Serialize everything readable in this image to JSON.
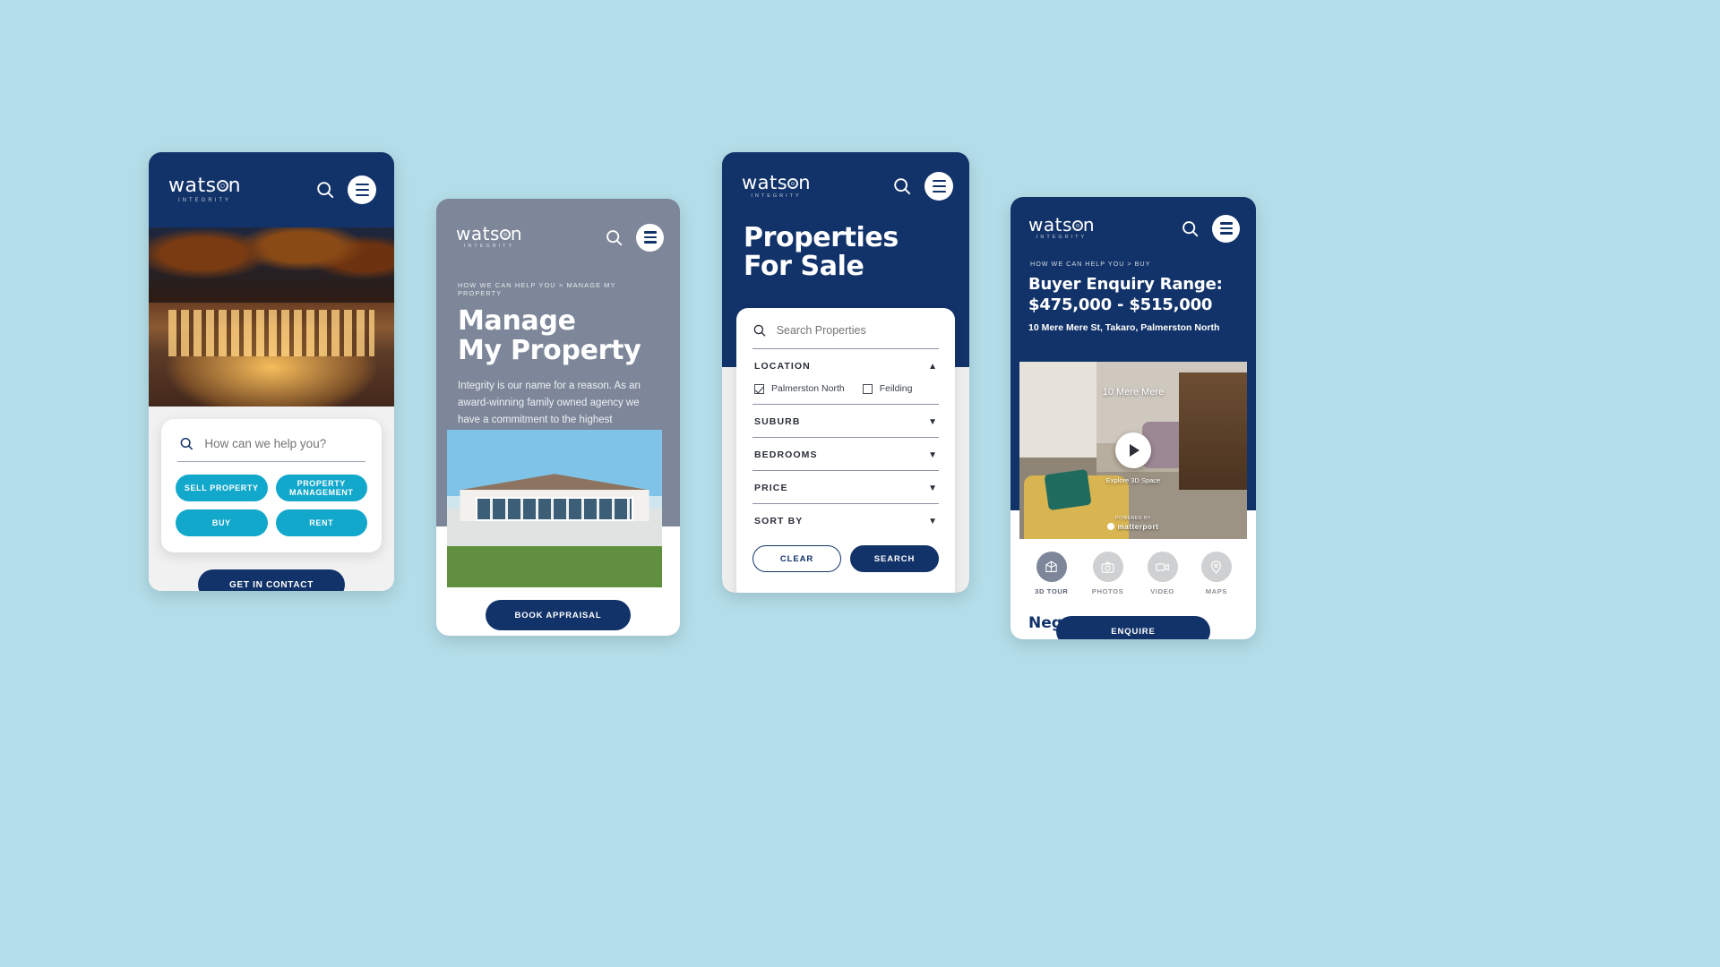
{
  "brand": {
    "word": "watson",
    "subtitle": "INTEGRITY",
    "navy": "#123369",
    "cyan": "#12a8cc",
    "grey": "#7d8799",
    "page_bg": "#b3dde8"
  },
  "phone1": {
    "name": "home-screen",
    "search": {
      "placeholder": "How can we help you?",
      "value": ""
    },
    "buttons": [
      {
        "label": "SELL PROPERTY"
      },
      {
        "label": "PROPERTY MANAGEMENT"
      },
      {
        "label": "BUY"
      },
      {
        "label": "RENT"
      }
    ],
    "cta": "GET IN CONTACT"
  },
  "phone2": {
    "name": "manage-my-property-screen",
    "breadcrumb": "HOW WE CAN HELP YOU > MANAGE MY PROPERTY",
    "title_line1": "Manage",
    "title_line2": "My Property",
    "intro": "Integrity is our name for a reason. As an award-winning family owned agency we have a commitment to the highest standards",
    "cta": "BOOK APPRAISAL"
  },
  "phone3": {
    "name": "properties-for-sale-screen",
    "title_line1": "Properties",
    "title_line2": "For Sale",
    "search": {
      "placeholder": "Search Properties",
      "value": ""
    },
    "filters": [
      {
        "label": "LOCATION",
        "caret": "▲",
        "expanded": true
      },
      {
        "label": "SUBURB",
        "caret": "▼",
        "expanded": false
      },
      {
        "label": "BEDROOMS",
        "caret": "▼",
        "expanded": false
      },
      {
        "label": "PRICE",
        "caret": "▼",
        "expanded": false
      },
      {
        "label": "SORT BY",
        "caret": "▼",
        "expanded": false
      }
    ],
    "location_options": [
      {
        "label": "Palmerston North",
        "checked": true
      },
      {
        "label": "Feilding",
        "checked": false
      }
    ],
    "actions": {
      "clear": "CLEAR",
      "search": "SEARCH"
    }
  },
  "phone4": {
    "name": "property-detail-screen",
    "breadcrumb": "HOW WE CAN HELP YOU > BUY",
    "title_line1": "Buyer Enquiry Range:",
    "title_line2": "$475,000 - $515,000",
    "address": "10 Mere Mere St, Takaro, Palmerston North",
    "media": {
      "label": "10 Mere Mere",
      "explore": "Explore 3D Space",
      "powered_by": "POWERED BY",
      "provider": "matterport"
    },
    "tabs": [
      {
        "label": "3D TOUR",
        "icon": "cube-icon",
        "active": true
      },
      {
        "label": "PHOTOS",
        "icon": "camera-icon",
        "active": false
      },
      {
        "label": "VIDEO",
        "icon": "video-icon",
        "active": false
      },
      {
        "label": "MAPS",
        "icon": "map-pin-icon",
        "active": false
      }
    ],
    "price": "Neg",
    "cta": "ENQUIRE"
  }
}
